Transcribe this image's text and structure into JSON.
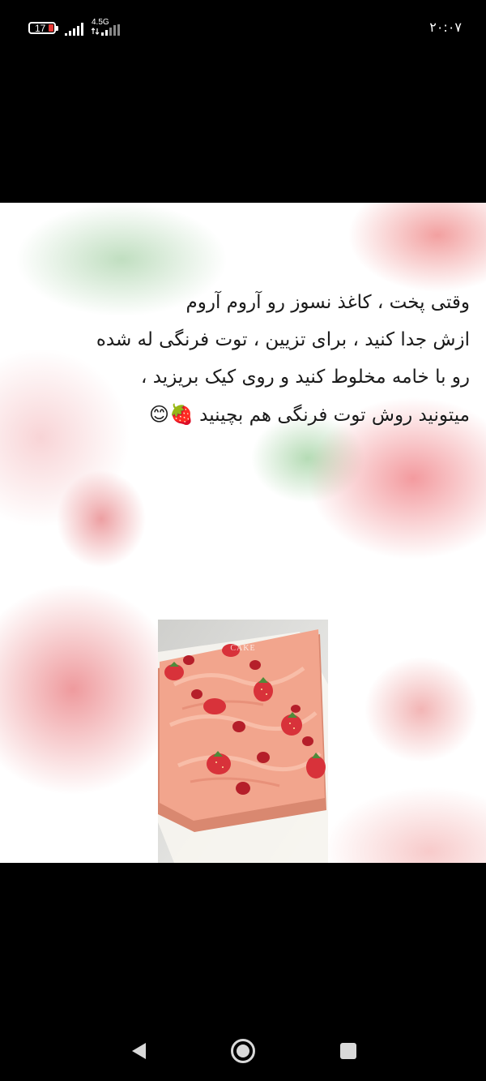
{
  "status_bar": {
    "battery_level": "17",
    "network_type": "4.5G",
    "time": "۲۰:۰۷"
  },
  "post": {
    "caption_lines": [
      "وقتی پخت ، کاغذ نسوز رو آروم آروم",
      "ازش جدا کنید ، برای تزیین ، توت فرنگی له شده",
      "رو با خامه مخلوط کنید و روی کیک بریزید ،",
      "میتونید روش توت فرنگی هم بچینید"
    ],
    "caption_emojis": "🍓😊",
    "photo_watermark": "CAKE"
  },
  "nav_bar": {
    "back_icon": "triangle-left",
    "home_icon": "circle",
    "recents_icon": "square"
  },
  "colors": {
    "background": "#000000",
    "panel": "#ffffff",
    "frosting": "#f2a58d",
    "strawberry": "#d8323a",
    "battery_low": "#e53935"
  }
}
